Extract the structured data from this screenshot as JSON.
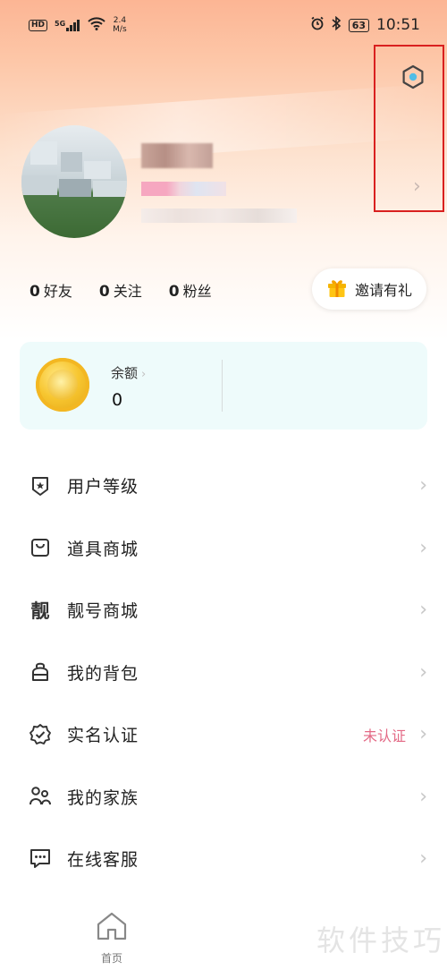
{
  "status_bar": {
    "network_badge": "HD",
    "signal_label": "5G",
    "speed_value": "2.4",
    "speed_unit": "M/s",
    "battery": "63",
    "time": "10:51"
  },
  "stats": [
    {
      "count": "0",
      "label": "好友"
    },
    {
      "count": "0",
      "label": "关注"
    },
    {
      "count": "0",
      "label": "粉丝"
    }
  ],
  "invite_label": "邀请有礼",
  "balance": {
    "label": "余额",
    "value": "0"
  },
  "menu": [
    {
      "label": "用户等级",
      "icon": "shield-star-icon",
      "status": ""
    },
    {
      "label": "道具商城",
      "icon": "shopping-bag-icon",
      "status": ""
    },
    {
      "label": "靓号商城",
      "icon": "liang-glyph-icon",
      "glyph": "靓",
      "status": ""
    },
    {
      "label": "我的背包",
      "icon": "backpack-icon",
      "status": ""
    },
    {
      "label": "实名认证",
      "icon": "verified-badge-icon",
      "status": "未认证"
    },
    {
      "label": "我的家族",
      "icon": "family-icon",
      "status": ""
    },
    {
      "label": "在线客服",
      "icon": "chat-icon",
      "status": ""
    }
  ],
  "nav": {
    "home_label": "首页"
  },
  "watermark": "软件技巧",
  "colors": {
    "status_unverified": "#e36a86",
    "highlight_box": "#d9201f",
    "balance_card_bg": "#eefbfb"
  }
}
